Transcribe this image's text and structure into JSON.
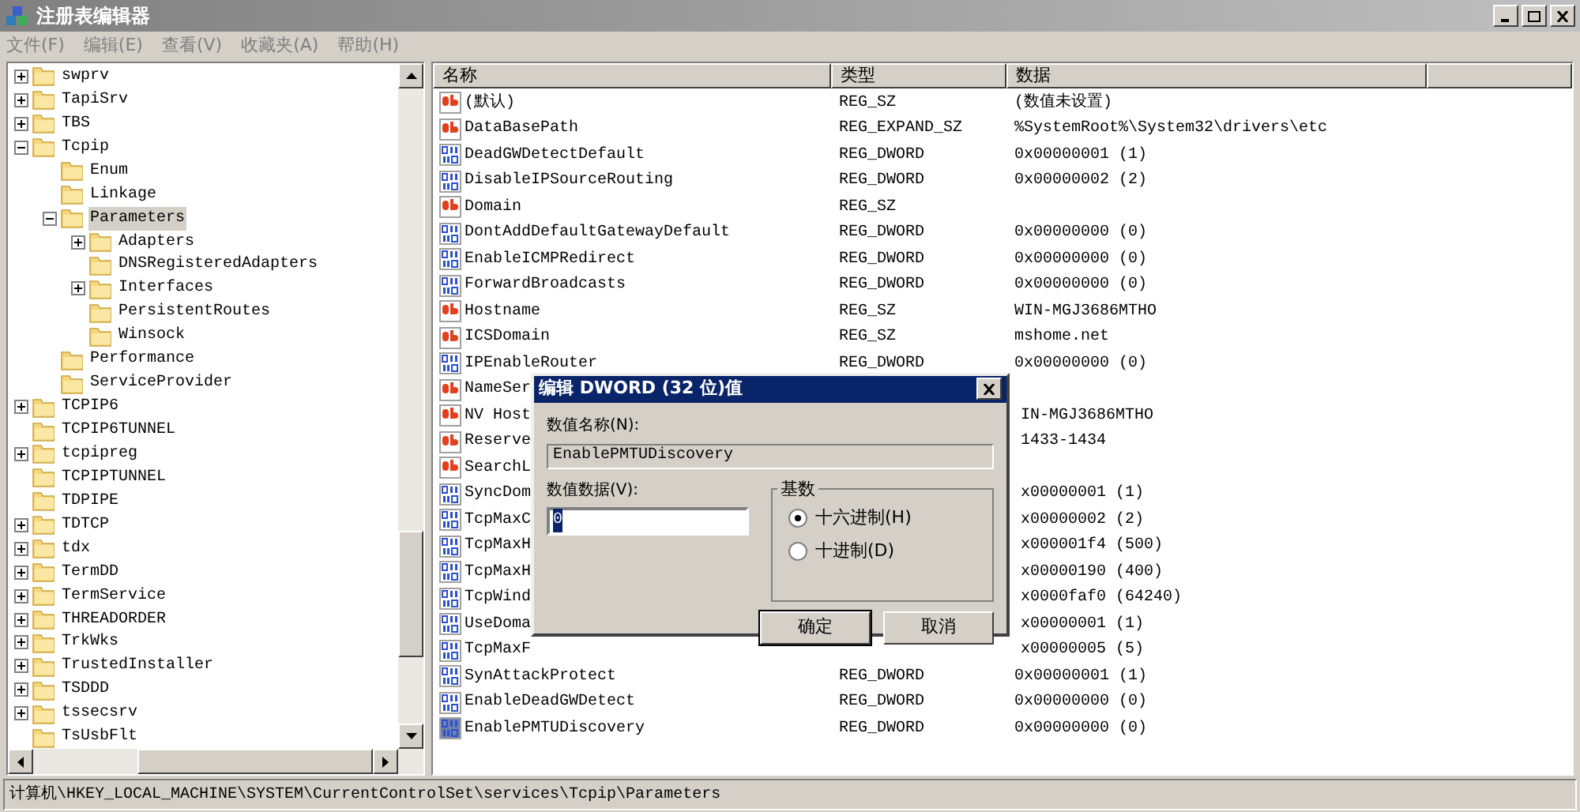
{
  "window": {
    "title": "注册表编辑器"
  },
  "menu": [
    "文件(F)",
    "编辑(E)",
    "查看(V)",
    "收藏夹(A)",
    "帮助(H)"
  ],
  "tree": [
    {
      "label": "swprv",
      "expanded": false,
      "selected": false
    },
    {
      "label": "TapiSrv",
      "expanded": false,
      "selected": false
    },
    {
      "label": "TBS",
      "expanded": false,
      "selected": false
    },
    {
      "label": "Tcpip",
      "expanded": true,
      "selected": false,
      "children": [
        {
          "label": "Enum",
          "selected": false
        },
        {
          "label": "Linkage",
          "selected": false
        },
        {
          "label": "Parameters",
          "expanded": true,
          "selected": true,
          "children": [
            {
              "label": "Adapters",
              "expanded": false,
              "selected": false
            },
            {
              "label": "DNSRegisteredAdapters",
              "selected": false
            },
            {
              "label": "Interfaces",
              "expanded": false,
              "selected": false
            },
            {
              "label": "PersistentRoutes",
              "selected": false
            },
            {
              "label": "Winsock",
              "selected": false
            }
          ]
        },
        {
          "label": "Performance",
          "selected": false
        },
        {
          "label": "ServiceProvider",
          "selected": false
        }
      ]
    },
    {
      "label": "TCPIP6",
      "expanded": false,
      "selected": false
    },
    {
      "label": "TCPIP6TUNNEL",
      "selected": false
    },
    {
      "label": "tcpipreg",
      "expanded": false,
      "selected": false
    },
    {
      "label": "TCPIPTUNNEL",
      "selected": false
    },
    {
      "label": "TDPIPE",
      "selected": false
    },
    {
      "label": "TDTCP",
      "expanded": false,
      "selected": false
    },
    {
      "label": "tdx",
      "expanded": false,
      "selected": false
    },
    {
      "label": "TermDD",
      "expanded": false,
      "selected": false
    },
    {
      "label": "TermService",
      "expanded": false,
      "selected": false
    },
    {
      "label": "THREADORDER",
      "expanded": false,
      "selected": false
    },
    {
      "label": "TrkWks",
      "expanded": false,
      "selected": false
    },
    {
      "label": "TrustedInstaller",
      "expanded": false,
      "selected": false
    },
    {
      "label": "TSDDD",
      "expanded": false,
      "selected": false
    },
    {
      "label": "tssecsrv",
      "expanded": false,
      "selected": false
    },
    {
      "label": "TsUsbFlt",
      "selected": false
    }
  ],
  "table": {
    "columns": [
      "名称",
      "类型",
      "数据"
    ],
    "rows": [
      {
        "kind": "string",
        "name": "(默认)",
        "type": "REG_SZ",
        "data": "(数值未设置)",
        "selected": false
      },
      {
        "kind": "string",
        "name": "DataBasePath",
        "type": "REG_EXPAND_SZ",
        "data": "%SystemRoot%\\System32\\drivers\\etc",
        "selected": false
      },
      {
        "kind": "binary",
        "name": "DeadGWDetectDefault",
        "type": "REG_DWORD",
        "data": "0x00000001 (1)",
        "selected": false
      },
      {
        "kind": "binary",
        "name": "DisableIPSourceRouting",
        "type": "REG_DWORD",
        "data": "0x00000002 (2)",
        "selected": false
      },
      {
        "kind": "string",
        "name": "Domain",
        "type": "REG_SZ",
        "selected": false
      },
      {
        "kind": "binary",
        "name": "DontAddDefaultGatewayDefault",
        "type": "REG_DWORD",
        "data": "0x00000000 (0)",
        "selected": false
      },
      {
        "kind": "binary",
        "name": "EnableICMPRedirect",
        "type": "REG_DWORD",
        "data": "0x00000000 (0)",
        "selected": false
      },
      {
        "kind": "binary",
        "name": "ForwardBroadcasts",
        "type": "REG_DWORD",
        "data": "0x00000000 (0)",
        "selected": false
      },
      {
        "kind": "string",
        "name": "Hostname",
        "type": "REG_SZ",
        "data": "WIN-MGJ3686MTHO",
        "selected": false
      },
      {
        "kind": "string",
        "name": "ICSDomain",
        "type": "REG_SZ",
        "data": "mshome.net",
        "selected": false
      },
      {
        "kind": "binary",
        "name": "IPEnableRouter",
        "type": "REG_DWORD",
        "data": "0x00000000 (0)",
        "selected": false
      },
      {
        "kind": "string",
        "name": "NameSer",
        "selected": false
      },
      {
        "kind": "string",
        "name": "NV Host",
        "data": "IN-MGJ3686MTHO",
        "selected": false
      },
      {
        "kind": "string",
        "name": "Reserve",
        "data": "1433-1434",
        "selected": false
      },
      {
        "kind": "string",
        "name": "SearchL",
        "selected": false
      },
      {
        "kind": "binary",
        "name": "SyncDom",
        "data": "x00000001 (1)",
        "selected": false
      },
      {
        "kind": "binary",
        "name": "TcpMaxC",
        "data": "x00000002 (2)",
        "selected": false
      },
      {
        "kind": "binary",
        "name": "TcpMaxH",
        "data": "x000001f4 (500)",
        "selected": false
      },
      {
        "kind": "binary",
        "name": "TcpMaxH",
        "data": "x00000190 (400)",
        "selected": false
      },
      {
        "kind": "binary",
        "name": "TcpWind",
        "data": "x0000faf0 (64240)",
        "selected": false
      },
      {
        "kind": "binary",
        "name": "UseDoma",
        "data": "x00000001 (1)",
        "selected": false
      },
      {
        "kind": "binary",
        "name": "TcpMaxF",
        "data": "x00000005 (5)",
        "selected": false
      },
      {
        "kind": "binary",
        "name": "SynAttackProtect",
        "type": "REG_DWORD",
        "data": "0x00000001 (1)",
        "selected": false
      },
      {
        "kind": "binary",
        "name": "EnableDeadGWDetect",
        "type": "REG_DWORD",
        "data": "0x00000000 (0)",
        "selected": false
      },
      {
        "kind": "binary",
        "name": "EnablePMTUDiscovery",
        "type": "REG_DWORD",
        "data": "0x00000000 (0)",
        "selected": true
      }
    ]
  },
  "dialog": {
    "title": "编辑 DWORD (32 位)值",
    "name_label": "数值名称(N):",
    "name_value": "EnablePMTUDiscovery",
    "data_label": "数值数据(V):",
    "data_value": "0",
    "base": {
      "label": "基数",
      "options": [
        {
          "label": "十六进制(H)",
          "selected": true
        },
        {
          "label": "十进制(D)",
          "selected": false
        }
      ]
    },
    "buttons": [
      {
        "label": "确定",
        "default": true
      },
      {
        "label": "取消",
        "default": false
      }
    ]
  },
  "status_bar": "计算机\\HKEY_LOCAL_MACHINE\\SYSTEM\\CurrentControlSet\\services\\Tcpip\\Parameters"
}
